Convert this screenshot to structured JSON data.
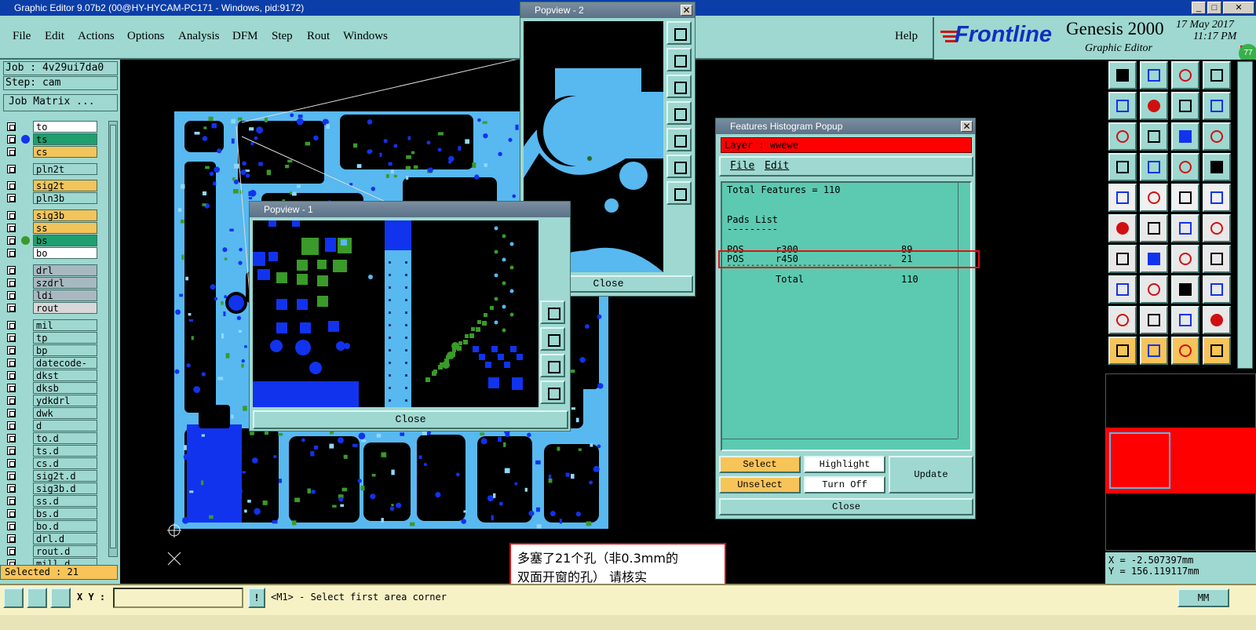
{
  "window": {
    "title": "Graphic Editor 9.07b2 (00@HY-HYCAM-PC171 - Windows, pid:9172)",
    "minimize": "_",
    "maximize": "□",
    "close": "✕"
  },
  "menu": {
    "file": "File",
    "edit": "Edit",
    "actions": "Actions",
    "options": "Options",
    "analysis": "Analysis",
    "dfm": "DFM",
    "step": "Step",
    "rout": "Rout",
    "windows": "Windows",
    "help": "Help"
  },
  "brand": {
    "logo": "Frontline",
    "product": "Genesis 2000",
    "subtitle": "Graphic Editor",
    "date": "17 May 2017",
    "time": "11:17 PM",
    "badge": "77"
  },
  "left": {
    "job": "Job : 4v29ui7da0",
    "step": "Step: cam",
    "job_matrix": "Job Matrix ..."
  },
  "layers": [
    {
      "name": "to",
      "bg": "#ffffff",
      "dot": ""
    },
    {
      "name": "ts",
      "bg": "#1f9e6e",
      "dot": "#1133ee"
    },
    {
      "name": "cs",
      "bg": "#f2c45a",
      "dot": ""
    },
    {
      "name": "pln2t",
      "bg": "#9ed8d0",
      "dot": ""
    },
    {
      "name": "sig2t",
      "bg": "#f2c45a",
      "dot": ""
    },
    {
      "name": "pln3b",
      "bg": "#9ed8d0",
      "dot": ""
    },
    {
      "name": "sig3b",
      "bg": "#f2c45a",
      "dot": ""
    },
    {
      "name": "ss",
      "bg": "#f2c45a",
      "dot": ""
    },
    {
      "name": "bs",
      "bg": "#1f9e6e",
      "dot": "#3a9a2a"
    },
    {
      "name": "bo",
      "bg": "#ffffff",
      "dot": ""
    },
    {
      "name": "drl",
      "bg": "#a8b8c0",
      "dot": ""
    },
    {
      "name": "szdrl",
      "bg": "#a8b8c0",
      "dot": ""
    },
    {
      "name": "ldi",
      "bg": "#a8b8c0",
      "dot": ""
    },
    {
      "name": "rout",
      "bg": "#d8d8d8",
      "dot": ""
    },
    {
      "name": "mil",
      "bg": "#9ed8d0",
      "dot": ""
    },
    {
      "name": "tp",
      "bg": "#9ed8d0",
      "dot": ""
    },
    {
      "name": "bp",
      "bg": "#9ed8d0",
      "dot": ""
    },
    {
      "name": "datecode-pte",
      "bg": "#9ed8d0",
      "dot": ""
    },
    {
      "name": "dkst",
      "bg": "#9ed8d0",
      "dot": ""
    },
    {
      "name": "dksb",
      "bg": "#9ed8d0",
      "dot": ""
    },
    {
      "name": "ydkdrl",
      "bg": "#9ed8d0",
      "dot": ""
    },
    {
      "name": "dwk",
      "bg": "#9ed8d0",
      "dot": ""
    },
    {
      "name": "d",
      "bg": "#9ed8d0",
      "dot": ""
    },
    {
      "name": "to.d",
      "bg": "#9ed8d0",
      "dot": ""
    },
    {
      "name": "ts.d",
      "bg": "#9ed8d0",
      "dot": ""
    },
    {
      "name": "cs.d",
      "bg": "#9ed8d0",
      "dot": ""
    },
    {
      "name": "sig2t.d",
      "bg": "#9ed8d0",
      "dot": ""
    },
    {
      "name": "sig3b.d",
      "bg": "#9ed8d0",
      "dot": ""
    },
    {
      "name": "ss.d",
      "bg": "#9ed8d0",
      "dot": ""
    },
    {
      "name": "bs.d",
      "bg": "#9ed8d0",
      "dot": ""
    },
    {
      "name": "bo.d",
      "bg": "#9ed8d0",
      "dot": ""
    },
    {
      "name": "drl.d",
      "bg": "#9ed8d0",
      "dot": ""
    },
    {
      "name": "rout.d",
      "bg": "#9ed8d0",
      "dot": ""
    },
    {
      "name": "mill.d",
      "bg": "#9ed8d0",
      "dot": ""
    }
  ],
  "selected": "Selected : 21",
  "popview1": {
    "title": "Popview - 1",
    "close": "Close"
  },
  "popview2": {
    "title": "Popview - 2",
    "close": "Close"
  },
  "histogram": {
    "title": "Features Histogram Popup",
    "layer": "Layer :  wwewe",
    "menu_file": "File",
    "menu_edit": "Edit",
    "total_features": "Total Features = 110",
    "pads_list": "Pads List",
    "pads_underline": "---------",
    "rows": [
      {
        "pol": "POS",
        "sym": "r300",
        "count": "89"
      },
      {
        "pol": "POS",
        "sym": "r450",
        "count": "21"
      }
    ],
    "separator": "-----------------------------------",
    "total_label": "Total",
    "total_value": "110",
    "select": "Select",
    "unselect": "Unselect",
    "highlight": "Highlight",
    "turn_off": "Turn Off",
    "update": "Update",
    "close": "Close"
  },
  "annotation": {
    "line1": "多塞了21个孔（非0.3mm的",
    "line2": "双面开窗的孔） 请核实"
  },
  "coords": {
    "x": "X = -2.507397mm",
    "y": "Y = 156.119117mm"
  },
  "bottom": {
    "xy_label": "X Y :",
    "xy_value": "",
    "prompt": "<M1> - Select first area corner",
    "units": "MM",
    "warn": "!"
  },
  "colors": {
    "panel": "#9ed8d0",
    "title_blue": "#0b3ea8",
    "board_cyan": "#58b8f0",
    "pad_blue": "#1133ee",
    "pad_green": "#3a9a2a",
    "red": "#ff0000",
    "highlight_yellow": "#f7c45a"
  }
}
